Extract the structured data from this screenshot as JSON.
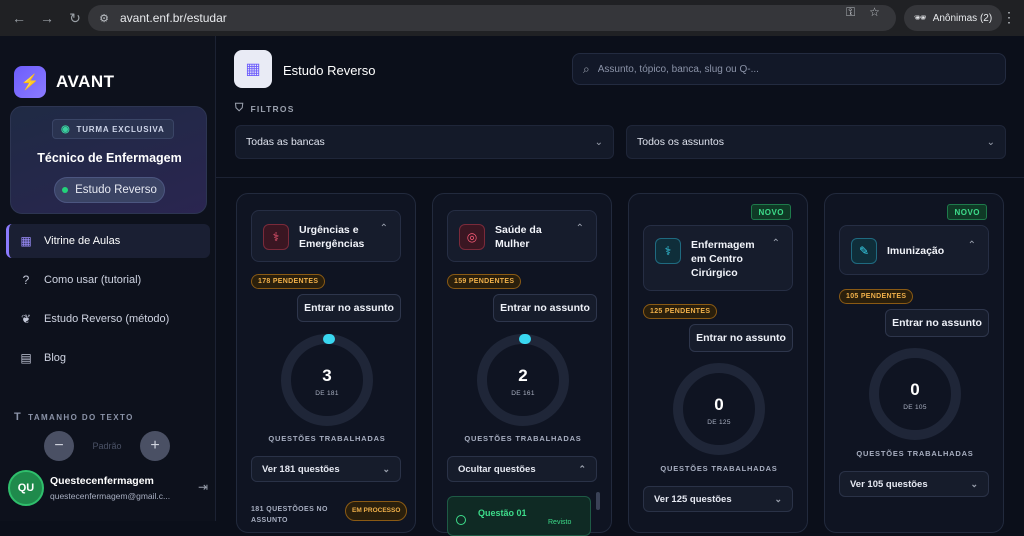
{
  "browser": {
    "url": "avant.enf.br/estudar",
    "incognito_label": "Anônimas (2)"
  },
  "sidebar": {
    "brand": "AVANT",
    "turma": {
      "badge": "TURMA EXCLUSIVA",
      "title": "Técnico de Enfermagem",
      "pill": "Estudo Reverso"
    },
    "items": [
      {
        "label": "Vitrine de Aulas",
        "icon": "grid-icon",
        "active": true
      },
      {
        "label": "Como usar (tutorial)",
        "icon": "help-circle-icon",
        "active": false
      },
      {
        "label": "Estudo Reverso (método)",
        "icon": "brain-icon",
        "active": false
      },
      {
        "label": "Blog",
        "icon": "newspaper-icon",
        "active": false
      }
    ],
    "text_size": {
      "label": "TAMANHO DO TEXTO",
      "minus": "−",
      "value": "Padrão",
      "plus": "+"
    },
    "user": {
      "initials": "QU",
      "name": "Questecenfermagem",
      "email": "questecenfermagem@gmail.c..."
    }
  },
  "header": {
    "title": "Estudo Reverso",
    "search_placeholder": "Assunto, tópico, banca, slug ou Q-...",
    "filters_label": "FILTROS",
    "banca_select": "Todas as bancas",
    "assunto_select": "Todos os assuntos"
  },
  "cards": [
    {
      "title_l1": "Urgências e",
      "title_l2": "Emergências",
      "title_l3": "",
      "icon": "stethoscope-icon",
      "pending": "178 PENDENTES",
      "enter": "Entrar no assunto",
      "count": "3",
      "of": "DE 181",
      "progress": 0.0166,
      "worked": "QUESTÕES TRABALHADAS",
      "toggle": "Ver 181 questões",
      "novo": "",
      "footer_text": "181 QUESTÕOES NO ASSUNTO",
      "footer_badge": "EM PROCESSO"
    },
    {
      "title_l1": "Saúde da",
      "title_l2": "Mulher",
      "title_l3": "",
      "icon": "female-icon",
      "pending": "159 PENDENTES",
      "enter": "Entrar no assunto",
      "count": "2",
      "of": "DE 161",
      "progress": 0.0124,
      "worked": "QUESTÕES TRABALHADAS",
      "toggle": "Ocultar questões",
      "novo": "",
      "question_title": "Questão 01",
      "question_status": "Revisto"
    },
    {
      "title_l1": "Enfermagem",
      "title_l2": "em Centro",
      "title_l3": "Cirúrgico",
      "icon": "stethoscope-icon",
      "pending": "125 PENDENTES",
      "enter": "Entrar no assunto",
      "count": "0",
      "of": "DE 125",
      "progress": 0,
      "worked": "QUESTÕES TRABALHADAS",
      "toggle": "Ver 125 questões",
      "novo": "NOVO"
    },
    {
      "title_l1": "Imunização",
      "title_l2": "",
      "title_l3": "",
      "icon": "syringe-icon",
      "pending": "105 PENDENTES",
      "enter": "Entrar no assunto",
      "count": "0",
      "of": "DE 105",
      "progress": 0,
      "worked": "QUESTÕES TRABALHADAS",
      "toggle": "Ver 105 questões",
      "novo": "NOVO"
    }
  ]
}
